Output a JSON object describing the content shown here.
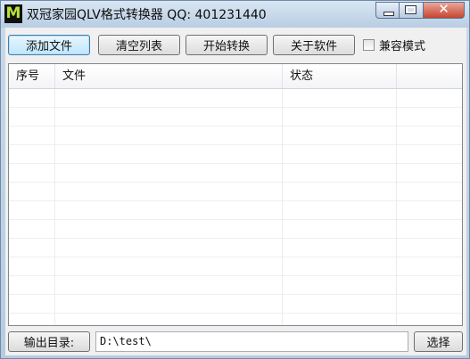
{
  "window": {
    "app_icon": "M",
    "title": "双冠家园QLV格式转换器 QQ: 401231440"
  },
  "toolbar": {
    "add_file": "添加文件",
    "clear_list": "清空列表",
    "start_convert": "开始转换",
    "about": "关于软件",
    "compat_mode": "兼容模式",
    "compat_checked": false
  },
  "list": {
    "columns": [
      "序号",
      "文件",
      "状态",
      ""
    ]
  },
  "output": {
    "label": "输出目录:",
    "path": "D:\\test\\",
    "choose": "选择"
  }
}
